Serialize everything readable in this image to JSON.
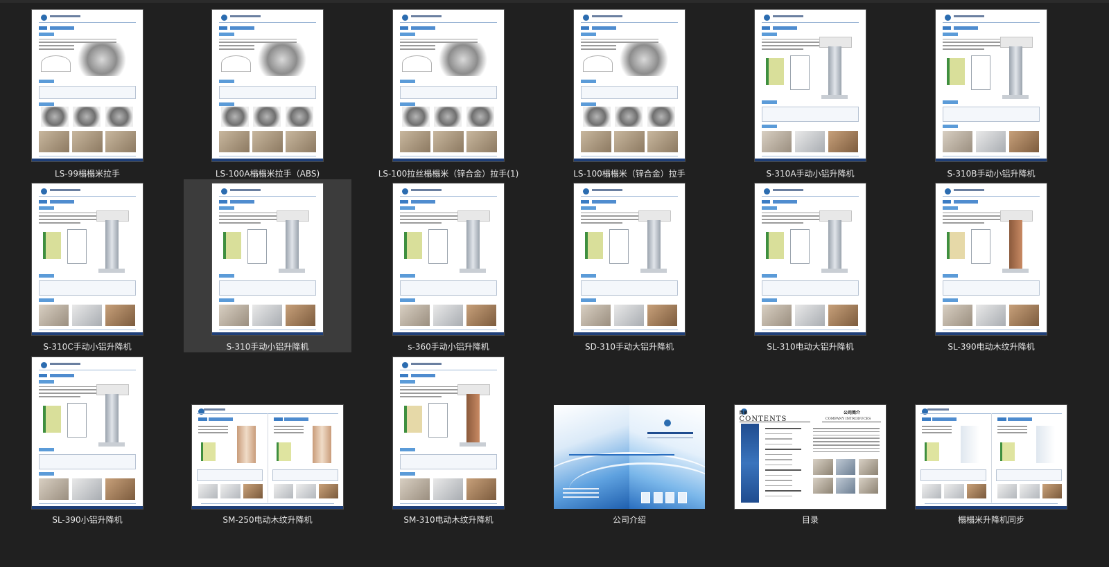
{
  "files": [
    {
      "name": "LS-99榻榻米拉手",
      "kind": "hardware"
    },
    {
      "name": "LS-100A榻榻米拉手（ABS)",
      "kind": "hardware"
    },
    {
      "name": "LS-100拉丝榻榻米（锌合金）拉手(1)",
      "kind": "hardware"
    },
    {
      "name": "LS-100榻榻米（锌合金）拉手",
      "kind": "hardware"
    },
    {
      "name": "S-310A手动小铝升降机",
      "kind": "lift"
    },
    {
      "name": "S-310B手动小铝升降机",
      "kind": "lift"
    },
    {
      "name": "S-310C手动小铝升降机",
      "kind": "lift"
    },
    {
      "name": "S-310手动小铝升降机",
      "kind": "lift",
      "selected": true
    },
    {
      "name": "s-360手动小铝升降机",
      "kind": "lift"
    },
    {
      "name": "SD-310手动大铝升降机",
      "kind": "lift"
    },
    {
      "name": "SL-310电动大铝升降机",
      "kind": "lift"
    },
    {
      "name": "SL-390电动木纹升降机",
      "kind": "wood"
    },
    {
      "name": "SL-390小铝升降机",
      "kind": "lift"
    },
    {
      "name": "SM-250电动木纹升降机",
      "kind": "spread"
    },
    {
      "name": "SM-310电动木纹升降机",
      "kind": "wood"
    },
    {
      "name": "公司介绍",
      "kind": "cover"
    },
    {
      "name": "目录",
      "kind": "contents"
    },
    {
      "name": "榻榻米升降机同步",
      "kind": "spread2"
    }
  ],
  "contents_page": {
    "heading": "目录",
    "english": "CONTENTS",
    "company_cn": "公司简介",
    "company_en": "COMPANY INTRODUCES"
  },
  "colors": {
    "background": "#202020",
    "selected": "#3c3c3c",
    "label": "#e7e7e7",
    "accent": "#2b6cb0"
  }
}
